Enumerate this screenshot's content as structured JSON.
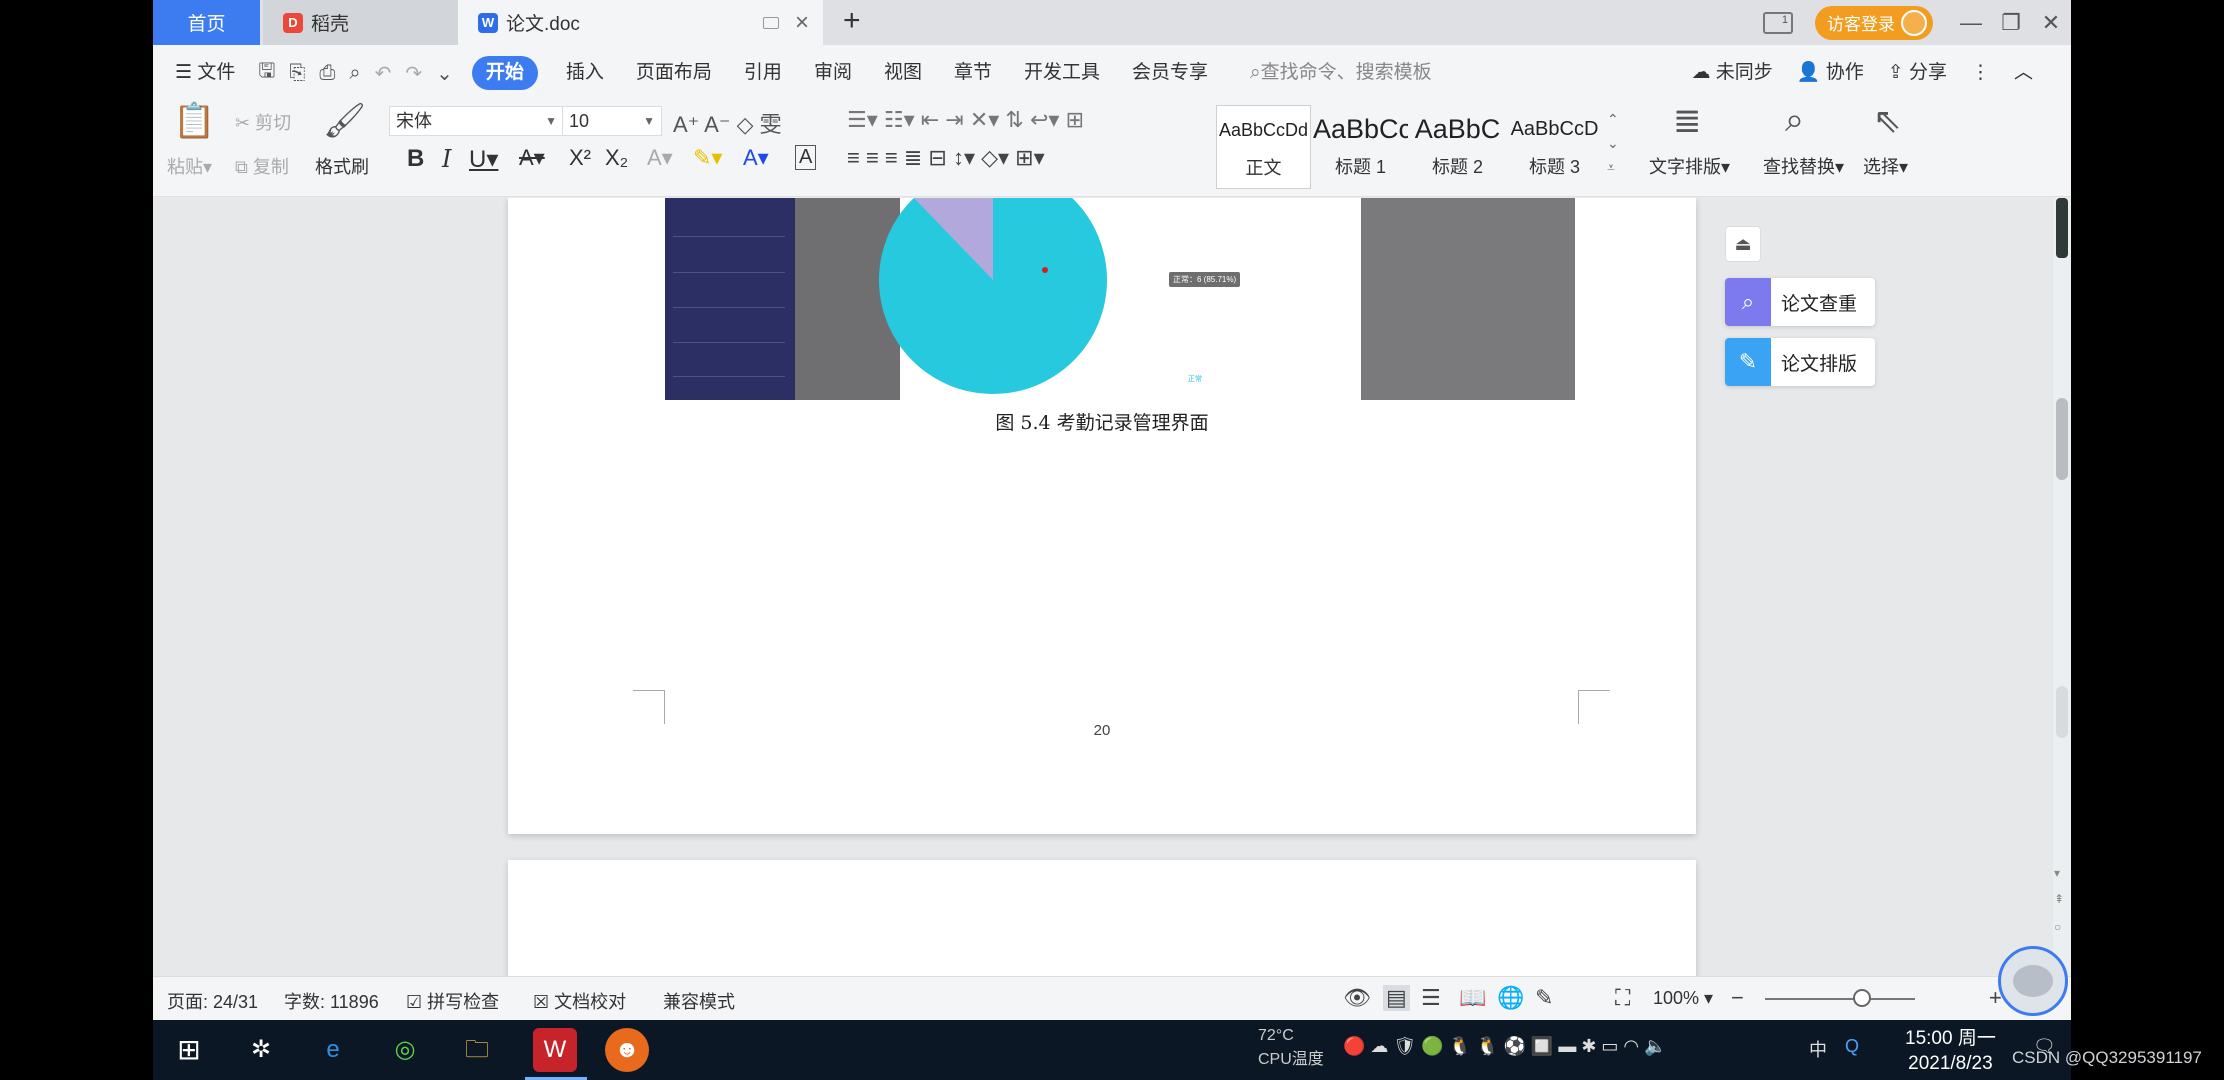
{
  "tabs": {
    "home": "首页",
    "daoke": "稻壳",
    "doc": "论文.doc",
    "new": "+"
  },
  "titlebar": {
    "visitor_login": "访客登录",
    "page_indicator": "1"
  },
  "menu": {
    "file": "文件",
    "start": "开始",
    "insert": "插入",
    "page_layout": "页面布局",
    "reference": "引用",
    "review": "审阅",
    "view": "视图",
    "chapter": "章节",
    "dev_tools": "开发工具",
    "member": "会员专享",
    "search_placeholder": "查找命令、搜索模板",
    "unsynced": "未同步",
    "collaborate": "协作",
    "share": "分享"
  },
  "ribbon": {
    "paste": "粘贴",
    "cut": "剪切",
    "copy": "复制",
    "format_painter": "格式刷",
    "font_name": "宋体",
    "font_size": "10",
    "styles": [
      {
        "sample": "AaBbCcDd",
        "name": "正文"
      },
      {
        "sample": "AaBbCc",
        "name": "标题 1"
      },
      {
        "sample": "AaBbC",
        "name": "标题 2"
      },
      {
        "sample": "AaBbCcD",
        "name": "标题 3"
      }
    ],
    "text_layout": "文字排版",
    "find_replace": "查找替换",
    "select": "选择"
  },
  "document": {
    "figure_caption": "图 5.4  考勤记录管理界面",
    "page_number": "20",
    "pie_tooltip": "正常：6 (85.71%)",
    "pie_legend": "正常",
    "colors": {
      "pie_main": "#27c9de",
      "pie_slice": "#b3a8dc"
    }
  },
  "side_panel": {
    "thesis_check": "论文查重",
    "thesis_format": "论文排版"
  },
  "status": {
    "page": "页面: 24/31",
    "words": "字数: 11896",
    "spell_check": "拼写检查",
    "doc_proof": "文档校对",
    "compat_mode": "兼容模式",
    "zoom": "100%"
  },
  "taskbar": {
    "temperature": "72°C",
    "cpu_label": "CPU温度",
    "ime": "中",
    "time": "15:00 周一",
    "date": "2021/8/23",
    "watermark": "CSDN @QQ3295391197"
  }
}
